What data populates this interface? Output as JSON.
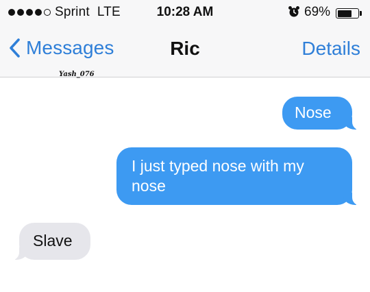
{
  "status_bar": {
    "carrier": "Sprint",
    "network": "LTE",
    "time": "10:28 AM",
    "battery_percent": "69%",
    "battery_level": 0.69,
    "signal_bars_filled": 4,
    "signal_bars_total": 5,
    "alarm_icon": "alarm-clock-icon"
  },
  "nav": {
    "back_label": "Messages",
    "contact_name": "Ric",
    "details_label": "Details"
  },
  "watermark": "Yash_076",
  "messages": [
    {
      "direction": "sent",
      "text": "Nose"
    },
    {
      "direction": "sent",
      "text": "I just typed nose with my nose"
    },
    {
      "direction": "received",
      "text": "Slave"
    }
  ],
  "colors": {
    "sent_bubble": "#3d9af2",
    "received_bubble": "#e6e6eb",
    "accent": "#2f7fd8"
  }
}
